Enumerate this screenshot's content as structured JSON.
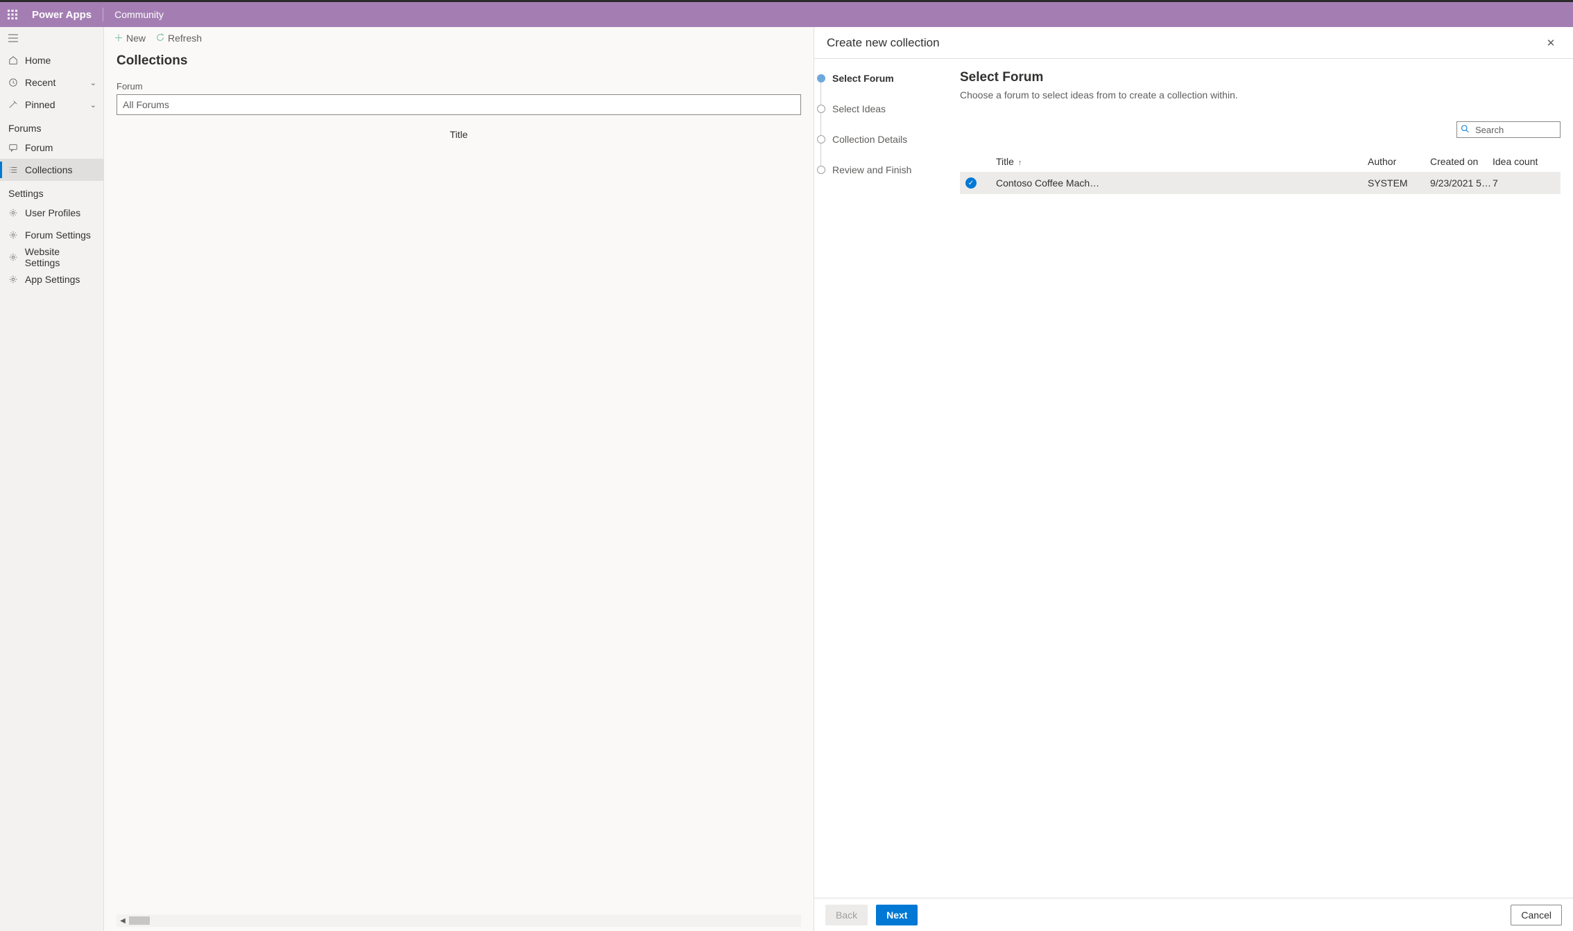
{
  "header": {
    "app_title": "Power Apps",
    "area": "Community"
  },
  "nav": {
    "home": "Home",
    "recent": "Recent",
    "pinned": "Pinned",
    "section_forums": "Forums",
    "forum": "Forum",
    "collections": "Collections",
    "section_settings": "Settings",
    "user_profiles": "User Profiles",
    "forum_settings": "Forum Settings",
    "website_settings": "Website Settings",
    "app_settings": "App Settings"
  },
  "mid": {
    "new": "New",
    "refresh": "Refresh",
    "title": "Collections",
    "forum_label": "Forum",
    "forum_placeholder": "All Forums",
    "col_title": "Title"
  },
  "panel": {
    "title": "Create new collection",
    "steps": [
      "Select Forum",
      "Select Ideas",
      "Collection Details",
      "Review and Finish"
    ],
    "content_title": "Select Forum",
    "content_sub": "Choose a forum to select ideas from to create a collection within.",
    "search_placeholder": "Search",
    "columns": {
      "title": "Title",
      "author": "Author",
      "created": "Created on",
      "idea": "Idea count"
    },
    "rows": [
      {
        "title": "Contoso Coffee Mach…",
        "author": "SYSTEM",
        "created": "9/23/2021 5:2…",
        "idea": "7"
      }
    ],
    "back": "Back",
    "next": "Next",
    "cancel": "Cancel"
  }
}
